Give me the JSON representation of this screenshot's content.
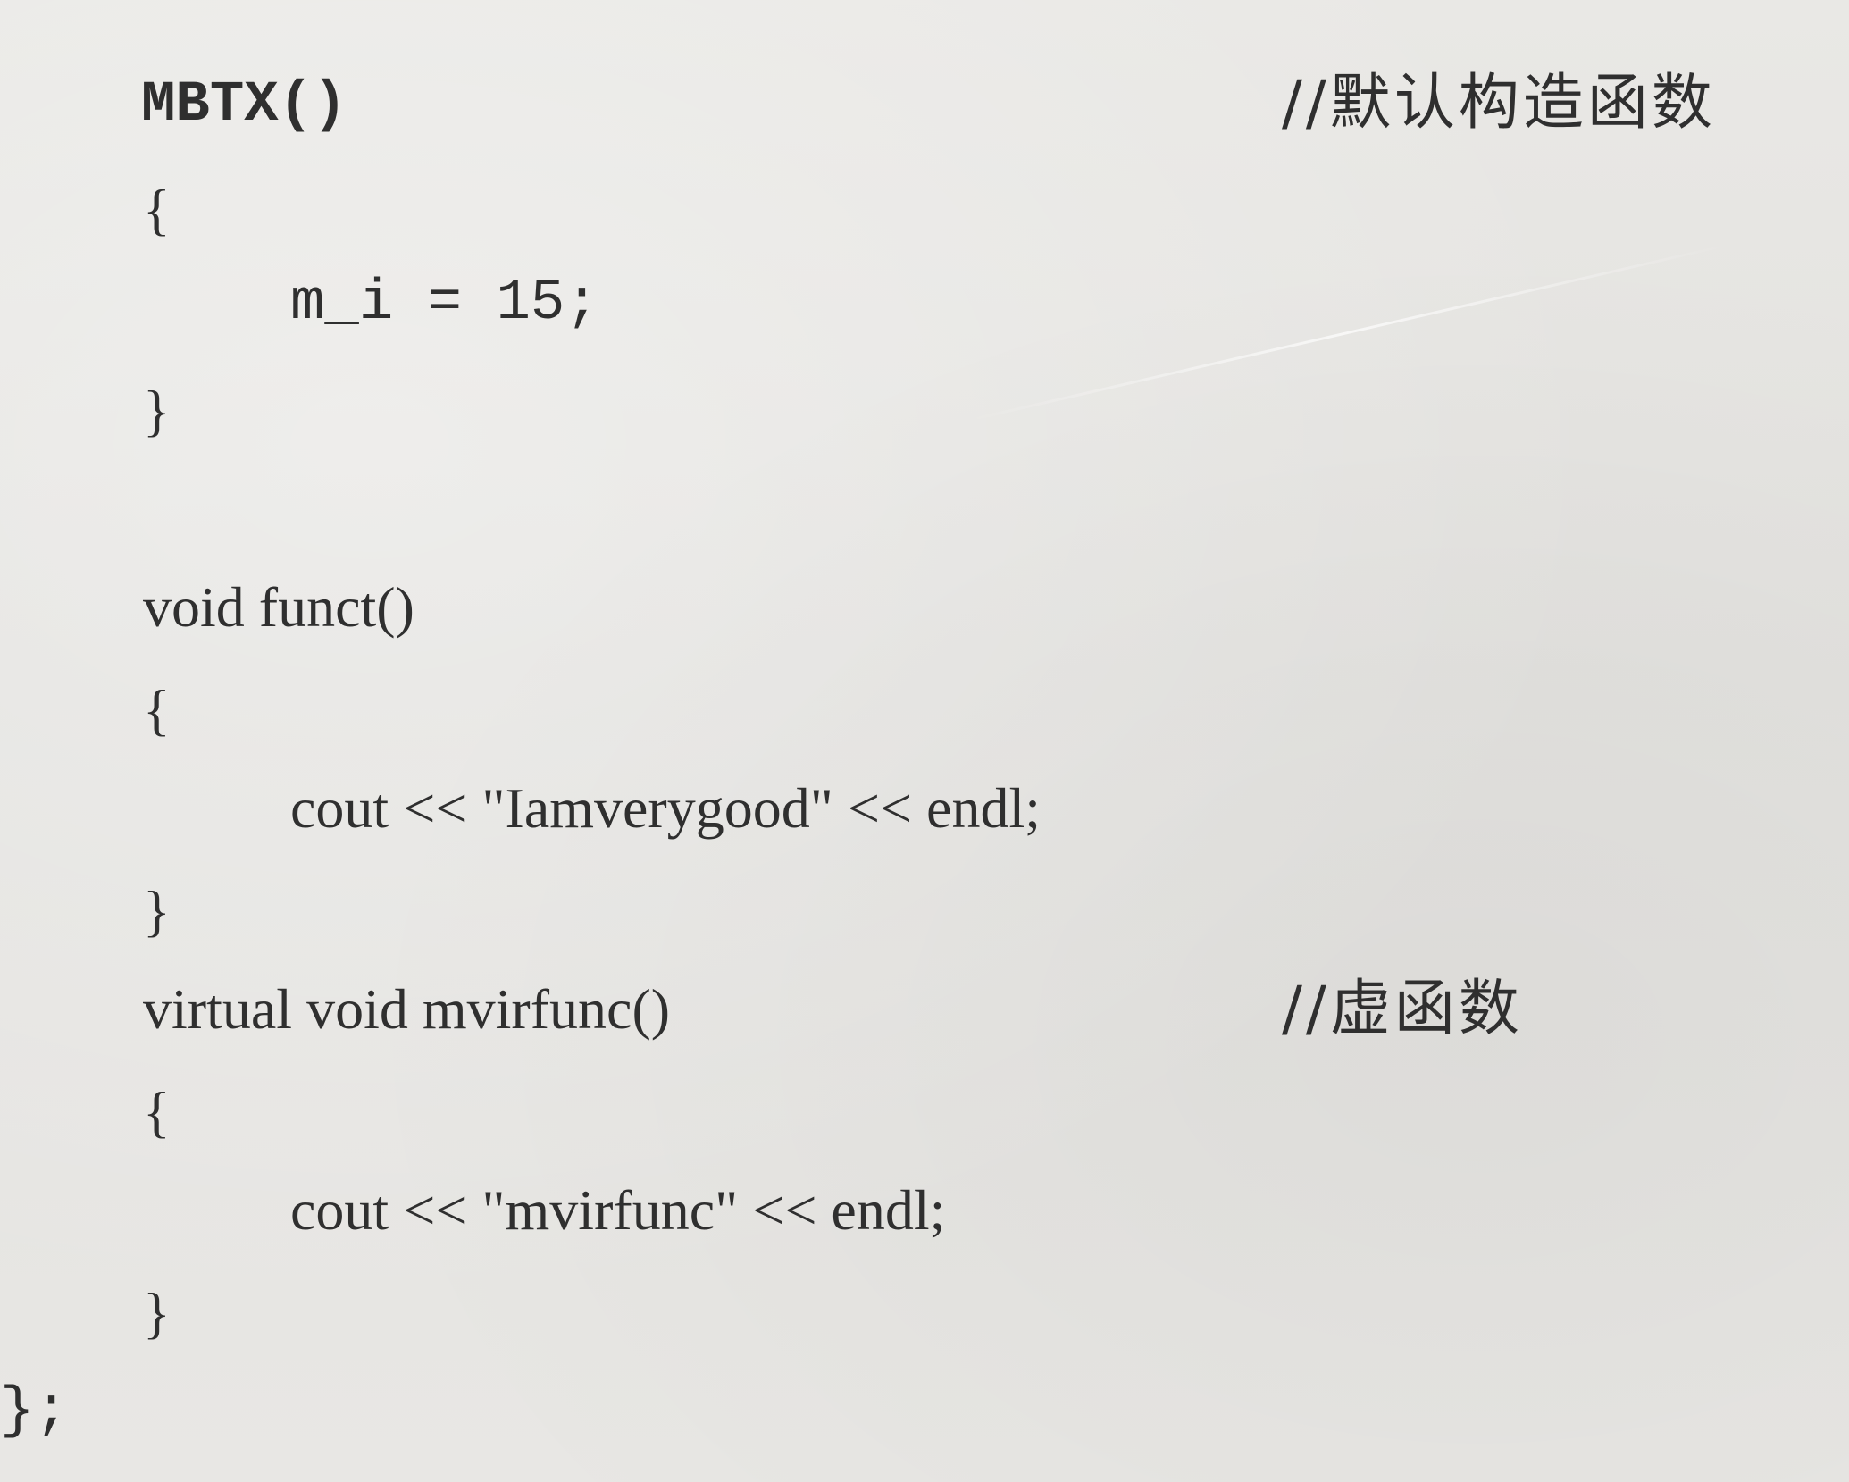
{
  "code_lines": [
    "MBTX()",
    "{",
    "m_i = 15;",
    "}",
    "void funct()",
    "{",
    "cout << \"Iamverygood\" << endl;",
    "}",
    "virtual void mvirfunc()",
    "{",
    "cout << \"mvirfunc\" << endl;",
    "}",
    "};"
  ],
  "comments": {
    "constructor": "//默认构造函数",
    "virtual": "//虚函数"
  }
}
